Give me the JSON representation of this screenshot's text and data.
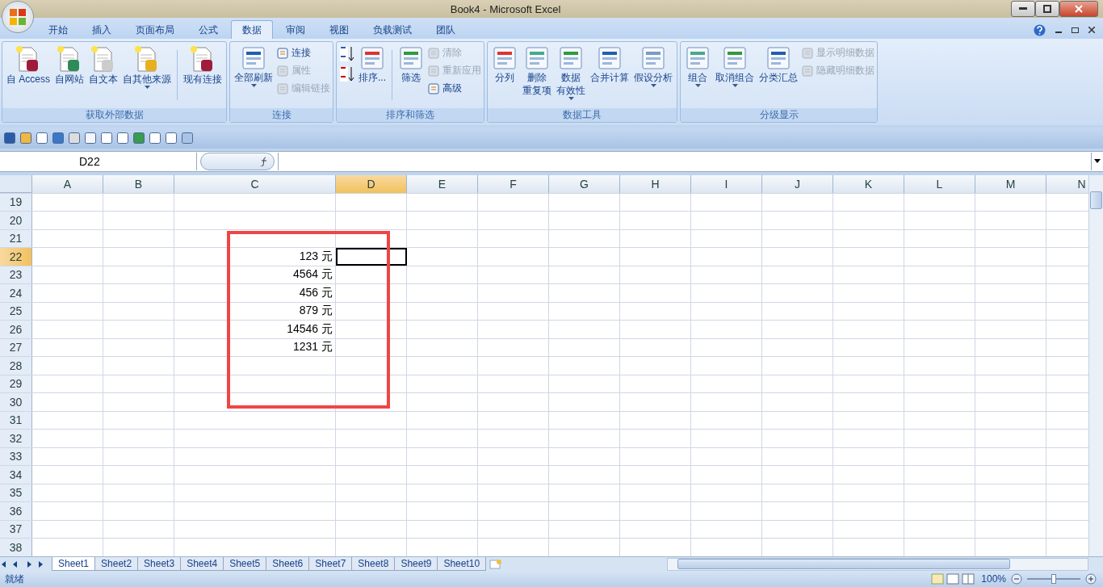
{
  "window": {
    "title": "Book4 - Microsoft Excel"
  },
  "ribbon_tabs": [
    {
      "label": "开始",
      "selected": false
    },
    {
      "label": "插入",
      "selected": false
    },
    {
      "label": "页面布局",
      "selected": false
    },
    {
      "label": "公式",
      "selected": false
    },
    {
      "label": "数据",
      "selected": true
    },
    {
      "label": "审阅",
      "selected": false
    },
    {
      "label": "视图",
      "selected": false
    },
    {
      "label": "负载测试",
      "selected": false
    },
    {
      "label": "团队",
      "selected": false
    }
  ],
  "ribbon_groups": [
    {
      "title": "获取外部数据",
      "items": [
        {
          "kind": "large",
          "label": "自 Access",
          "disabled": false,
          "dropdown": false
        },
        {
          "kind": "large",
          "label": "自网站",
          "disabled": false,
          "dropdown": false
        },
        {
          "kind": "large",
          "label": "自文本",
          "disabled": false,
          "dropdown": false
        },
        {
          "kind": "large",
          "label": "自其他来源",
          "disabled": false,
          "dropdown": true
        },
        {
          "kind": "separator"
        },
        {
          "kind": "large",
          "label": "现有连接",
          "disabled": false,
          "dropdown": false
        }
      ]
    },
    {
      "title": "连接",
      "items": [
        {
          "kind": "large",
          "label": "全部刷新",
          "disabled": false,
          "dropdown": true
        },
        {
          "kind": "stack",
          "items": [
            {
              "label": "连接",
              "disabled": false
            },
            {
              "label": "属性",
              "disabled": true
            },
            {
              "label": "编辑链接",
              "disabled": true
            }
          ]
        }
      ]
    },
    {
      "title": "排序和筛选",
      "items": [
        {
          "kind": "sort"
        },
        {
          "kind": "large",
          "label": "排序...",
          "disabled": false,
          "dropdown": false
        },
        {
          "kind": "separator"
        },
        {
          "kind": "large",
          "label": "筛选",
          "disabled": false,
          "dropdown": false
        },
        {
          "kind": "stack",
          "items": [
            {
              "label": "清除",
              "disabled": true
            },
            {
              "label": "重新应用",
              "disabled": true
            },
            {
              "label": "高级",
              "disabled": false
            }
          ]
        }
      ]
    },
    {
      "title": "数据工具",
      "items": [
        {
          "kind": "large",
          "label": "分列",
          "disabled": false,
          "dropdown": false
        },
        {
          "kind": "large",
          "label_lines": [
            "删除",
            "重复项"
          ],
          "disabled": false,
          "dropdown": false
        },
        {
          "kind": "large",
          "label_lines": [
            "数据",
            "有效性"
          ],
          "disabled": false,
          "dropdown": true
        },
        {
          "kind": "large",
          "label": "合并计算",
          "disabled": false,
          "dropdown": false
        },
        {
          "kind": "large",
          "label": "假设分析",
          "disabled": false,
          "dropdown": true
        }
      ]
    },
    {
      "title": "分级显示",
      "items": [
        {
          "kind": "large",
          "label": "组合",
          "disabled": false,
          "dropdown": true
        },
        {
          "kind": "large",
          "label": "取消组合",
          "disabled": false,
          "dropdown": true
        },
        {
          "kind": "large",
          "label": "分类汇总",
          "disabled": false,
          "dropdown": false
        },
        {
          "kind": "stack",
          "items": [
            {
              "label": "显示明细数据",
              "disabled": true
            },
            {
              "label": "隐藏明细数据",
              "disabled": true
            }
          ]
        }
      ]
    }
  ],
  "name_box": "D22",
  "columns": [
    {
      "label": "A",
      "selected": false
    },
    {
      "label": "B",
      "selected": false
    },
    {
      "label": "C",
      "selected": false
    },
    {
      "label": "D",
      "selected": true
    },
    {
      "label": "E",
      "selected": false
    },
    {
      "label": "F",
      "selected": false
    },
    {
      "label": "G",
      "selected": false
    },
    {
      "label": "H",
      "selected": false
    },
    {
      "label": "I",
      "selected": false
    },
    {
      "label": "J",
      "selected": false
    },
    {
      "label": "K",
      "selected": false
    },
    {
      "label": "L",
      "selected": false
    },
    {
      "label": "M",
      "selected": false
    },
    {
      "label": "N",
      "selected": false
    }
  ],
  "rows": [
    {
      "number": "19",
      "selected": false
    },
    {
      "number": "20",
      "selected": false
    },
    {
      "number": "21",
      "selected": false
    },
    {
      "number": "22",
      "selected": true,
      "column_c": "123 元"
    },
    {
      "number": "23",
      "selected": false,
      "column_c": "4564 元"
    },
    {
      "number": "24",
      "selected": false,
      "column_c": "456 元"
    },
    {
      "number": "25",
      "selected": false,
      "column_c": "879 元"
    },
    {
      "number": "26",
      "selected": false,
      "column_c": "14546 元"
    },
    {
      "number": "27",
      "selected": false,
      "column_c": "1231 元"
    },
    {
      "number": "28",
      "selected": false
    },
    {
      "number": "29",
      "selected": false
    },
    {
      "number": "30",
      "selected": false
    },
    {
      "number": "31",
      "selected": false
    },
    {
      "number": "32",
      "selected": false
    },
    {
      "number": "33",
      "selected": false
    },
    {
      "number": "34",
      "selected": false
    },
    {
      "number": "35",
      "selected": false
    },
    {
      "number": "36",
      "selected": false
    },
    {
      "number": "37",
      "selected": false
    },
    {
      "number": "38",
      "selected": false
    }
  ],
  "sheet_tabs": [
    {
      "label": "Sheet1",
      "selected": true
    },
    {
      "label": "Sheet2",
      "selected": false
    },
    {
      "label": "Sheet3",
      "selected": false
    },
    {
      "label": "Sheet4",
      "selected": false
    },
    {
      "label": "Sheet5",
      "selected": false
    },
    {
      "label": "Sheet6",
      "selected": false
    },
    {
      "label": "Sheet7",
      "selected": false
    },
    {
      "label": "Sheet8",
      "selected": false
    },
    {
      "label": "Sheet9",
      "selected": false
    },
    {
      "label": "Sheet10",
      "selected": false
    }
  ],
  "status_bar": {
    "status": "就绪",
    "zoom": "100%",
    "zoom_slider": {
      "level": 0.5
    }
  }
}
